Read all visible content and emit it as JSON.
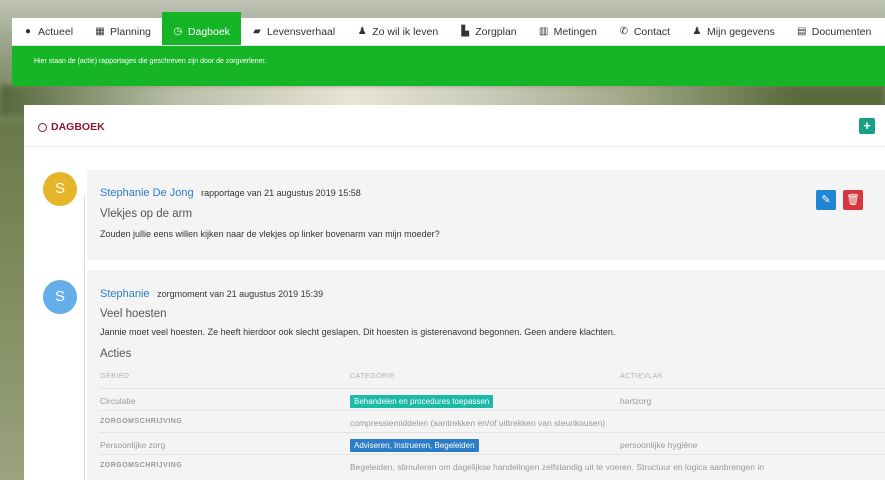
{
  "nav": {
    "tabs": [
      {
        "label": "Actueel",
        "icon": "dashboard-icon",
        "glyph": "●"
      },
      {
        "label": "Planning",
        "icon": "calendar-icon",
        "glyph": "▦"
      },
      {
        "label": "Dagboek",
        "icon": "clock-icon",
        "glyph": "◷"
      },
      {
        "label": "Levensverhaal",
        "icon": "book-icon",
        "glyph": "▰"
      },
      {
        "label": "Zo wil ik leven",
        "icon": "user-icon",
        "glyph": "♟"
      },
      {
        "label": "Zorgplan",
        "icon": "file-icon",
        "glyph": "▙"
      },
      {
        "label": "Metingen",
        "icon": "chart-icon",
        "glyph": "▥"
      },
      {
        "label": "Contact",
        "icon": "phone-icon",
        "glyph": "✆"
      },
      {
        "label": "Mijn gegevens",
        "icon": "user-icon",
        "glyph": "♟"
      },
      {
        "label": "Documenten",
        "icon": "document-icon",
        "glyph": "▤"
      }
    ],
    "active_index": 2
  },
  "infobar": {
    "text": "Hier staan de (actie) rapportages die geschreven zijn door de zorgverlener."
  },
  "panel": {
    "title": "DAGBOEK",
    "add_glyph": "+"
  },
  "entries": [
    {
      "avatar": "S",
      "avatar_color": "#e6b62a",
      "name": "Stephanie De Jong",
      "subtitle": "rapportage van 21 augustus 2019 15:58",
      "title": "Vlekjes op de arm",
      "body": "Zouden jullie eens willen kijken naar de vlekjes op linker bovenarm van mijn moeder?",
      "edit_glyph": "✎",
      "delete_glyph": "🗑"
    },
    {
      "avatar": "S",
      "avatar_color": "#64aee9",
      "name": "Stephanie",
      "subtitle": "zorgmoment van 21 augustus 2019 15:39",
      "title": "Veel hoesten",
      "body": "Jannie moet veel hoesten. Ze heeft hierdoor ook slecht geslapen. Dit hoesten is gisterenavond begonnen. Geen andere klachten.",
      "acties_label": "Acties",
      "columns": [
        "GEBIED",
        "CATEGORIE",
        "ACTIEVLAK"
      ],
      "rows": [
        {
          "gebied": "Circulatie",
          "categorie": "Behandelen en procedures toepassen",
          "actievlak": "hartzorg"
        },
        {
          "label": "ZORGOMSCHRIJVING",
          "text": "compressiemiddelen (aantrekken en/of uittrekken van steunkousen)"
        },
        {
          "gebied": "Persoonlijke zorg",
          "categorie": "Adviseren, Instrueren, Begeleiden",
          "actievlak": "persoonlijke hygiëne"
        },
        {
          "label": "ZORGOMSCHRIJVING",
          "text": "Begeleiden, stimuleren om dagelijkse handelingen zelfstandig uit te voeren. Structuur en logica aanbrengen in"
        }
      ]
    }
  ]
}
